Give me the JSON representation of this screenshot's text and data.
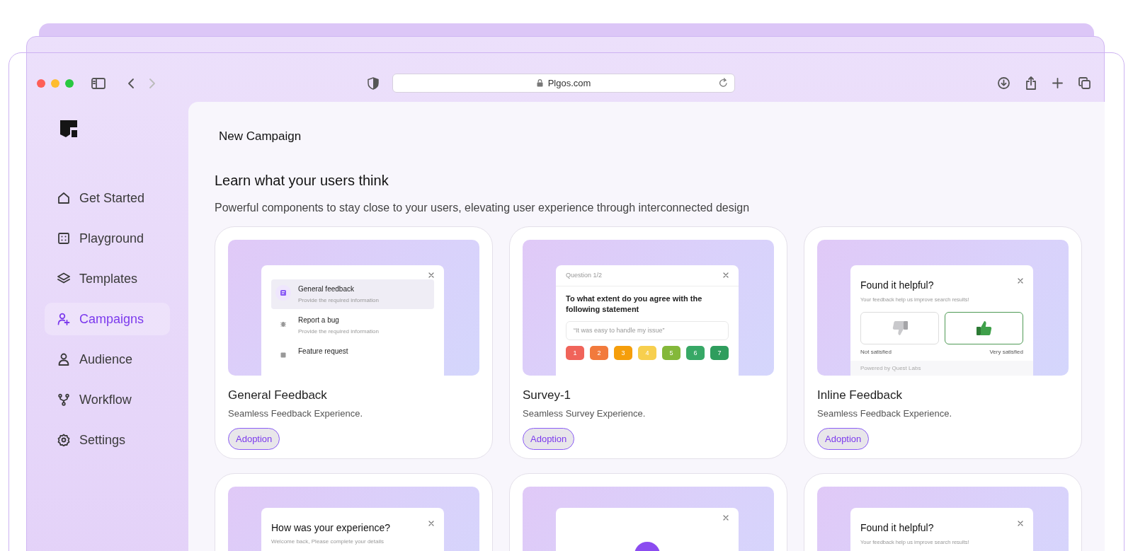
{
  "browser": {
    "url": "Plgos.com",
    "nav": [
      {
        "kind": "back",
        "disabled": false
      },
      {
        "kind": "forward",
        "disabled": true
      }
    ]
  },
  "sidebar": {
    "items": [
      {
        "kind": "home",
        "label": "Get Started",
        "selected": false
      },
      {
        "kind": "grid",
        "label": "Playground",
        "selected": false
      },
      {
        "kind": "layers",
        "label": "Templates",
        "selected": false
      },
      {
        "kind": "user-plus",
        "label": "Campaigns",
        "selected": true
      },
      {
        "kind": "user",
        "label": "Audience",
        "selected": false
      },
      {
        "kind": "branch",
        "label": "Workflow",
        "selected": false
      },
      {
        "kind": "gear",
        "label": "Settings",
        "selected": false
      }
    ]
  },
  "page": {
    "title": "New Campaign",
    "heading": "Learn what your users think",
    "subtitle": "Powerful components to stay close to your users, elevating user experience through interconnected design"
  },
  "templates": [
    {
      "kind": "options",
      "title": "General Feedback",
      "description": "Seamless Feedback Experience.",
      "tag": "Adoption",
      "preview": {
        "items": [
          {
            "kind": "feedback",
            "title": "General feedback",
            "subtitle": "Provide the required information",
            "selected": true
          },
          {
            "kind": "bug",
            "title": "Report a bug",
            "subtitle": "Provide the required information",
            "selected": false
          },
          {
            "kind": "feature",
            "title": "Feature request",
            "selected": false
          }
        ]
      }
    },
    {
      "kind": "survey",
      "title": "Survey-1",
      "description": "Seamless Survey Experience.",
      "tag": "Adoption",
      "preview": {
        "label": "Question 1/2",
        "question": "To what extent do you agree with the following statement",
        "quote": "“It was easy to handle my issue”",
        "scale": [
          {
            "label": "1",
            "color": "#f0645a"
          },
          {
            "label": "2",
            "color": "#f27a3c"
          },
          {
            "label": "3",
            "color": "#f59e0b"
          },
          {
            "label": "4",
            "color": "#f7cf4e"
          },
          {
            "label": "5",
            "color": "#84b83a"
          },
          {
            "label": "6",
            "color": "#37a866"
          },
          {
            "label": "7",
            "color": "#2f9d5d"
          }
        ]
      }
    },
    {
      "kind": "thumbs",
      "title": "Inline Feedback",
      "description": "Seamless Feedback Experience.",
      "tag": "Adoption",
      "preview": {
        "title": "Found it helpful?",
        "subtitle": "Your feedback help us improve search results!",
        "options": [
          {
            "kind": "down",
            "label": "Not satisfied",
            "selected": false
          },
          {
            "kind": "up",
            "label": "Very satisfied",
            "selected": true
          }
        ],
        "footer": "Powered by Quest Labs"
      }
    },
    {
      "kind": "form",
      "preview": {
        "title": "How was your experience?",
        "subtitle": "Welcome back, Please complete your details"
      }
    },
    {
      "kind": "graphic"
    },
    {
      "kind": "thumbs",
      "preview": {
        "title": "Found it helpful?",
        "subtitle": "Your feedback help us improve search results!"
      }
    }
  ]
}
